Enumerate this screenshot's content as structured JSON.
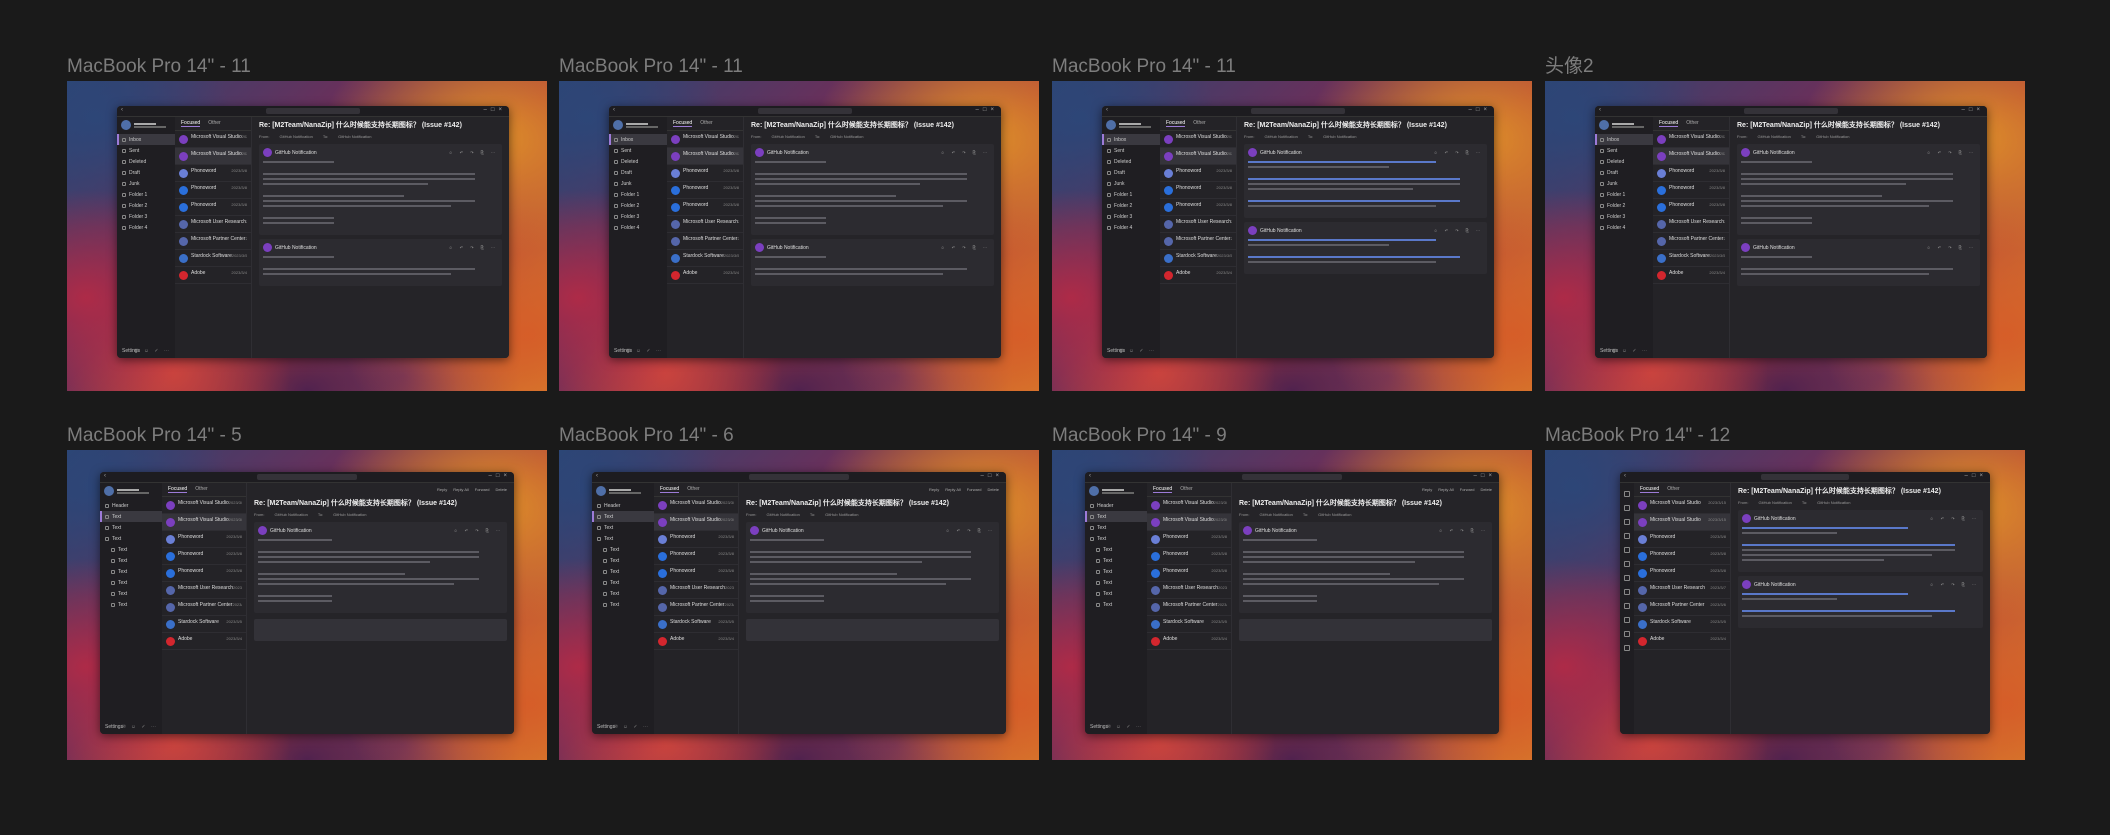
{
  "frames": [
    {
      "label": "MacBook Pro 14\" - 11",
      "variant": "full"
    },
    {
      "label": "MacBook Pro 14\" - 11",
      "variant": "full"
    },
    {
      "label": "MacBook Pro 14\" - 11",
      "variant": "thread"
    },
    {
      "label": "头像2",
      "variant": "full"
    },
    {
      "label": "MacBook Pro 14\" - 5",
      "variant": "expanded"
    },
    {
      "label": "MacBook Pro 14\" - 6",
      "variant": "expanded"
    },
    {
      "label": "MacBook Pro 14\" - 9",
      "variant": "expanded"
    },
    {
      "label": "MacBook Pro 14\" - 12",
      "variant": "compact"
    }
  ],
  "app": {
    "user_name": "Nick Sze",
    "list_tabs": [
      "Focused",
      "Other"
    ],
    "folders_basic": [
      "Inbox",
      "Sent",
      "Deleted",
      "Draft",
      "Junk",
      "Folder 1",
      "Folder 2",
      "Folder 3",
      "Folder 4"
    ],
    "folders_tree": [
      "Header",
      "Text",
      "Text",
      "Text",
      "Text",
      "Text",
      "Text",
      "Text",
      "Text",
      "Text"
    ],
    "settings_label": "Settings",
    "messages": [
      {
        "sender": "Microsoft Visual Studio",
        "color": "#7b3fbf",
        "date": "2023/3/15"
      },
      {
        "sender": "Microsoft Visual Studio",
        "color": "#7b3fbf",
        "date": "2023/3/15"
      },
      {
        "sender": "Phonoword",
        "color": "#6a7fd6",
        "date": "2023/3/8"
      },
      {
        "sender": "Phonoword",
        "color": "#2a6fdb",
        "date": "2023/3/8"
      },
      {
        "sender": "Phonoword",
        "color": "#2a6fdb",
        "date": "2023/3/8"
      },
      {
        "sender": "Microsoft User Research",
        "color": "#5566aa",
        "date": "2023/3/7"
      },
      {
        "sender": "Microsoft Partner Center",
        "color": "#5566aa",
        "date": "2023/3/6"
      },
      {
        "sender": "Stardock Software",
        "color": "#3a6fc8",
        "date": "2023/3/5"
      },
      {
        "sender": "Adobe",
        "color": "#d3262e",
        "date": "2023/3/4"
      }
    ],
    "reader": {
      "subject": "Re: [M2Team/NanaZip] 什么时候能支持长期图标？ (Issue #142)",
      "from_label": "From:",
      "from_value": "GitHub Notification",
      "to_label": "To:",
      "to_value": "GitHub Notification",
      "card_sender": "GitHub Notification",
      "toolbar": [
        "Reply",
        "Reply All",
        "Forward",
        "Delete"
      ]
    }
  }
}
